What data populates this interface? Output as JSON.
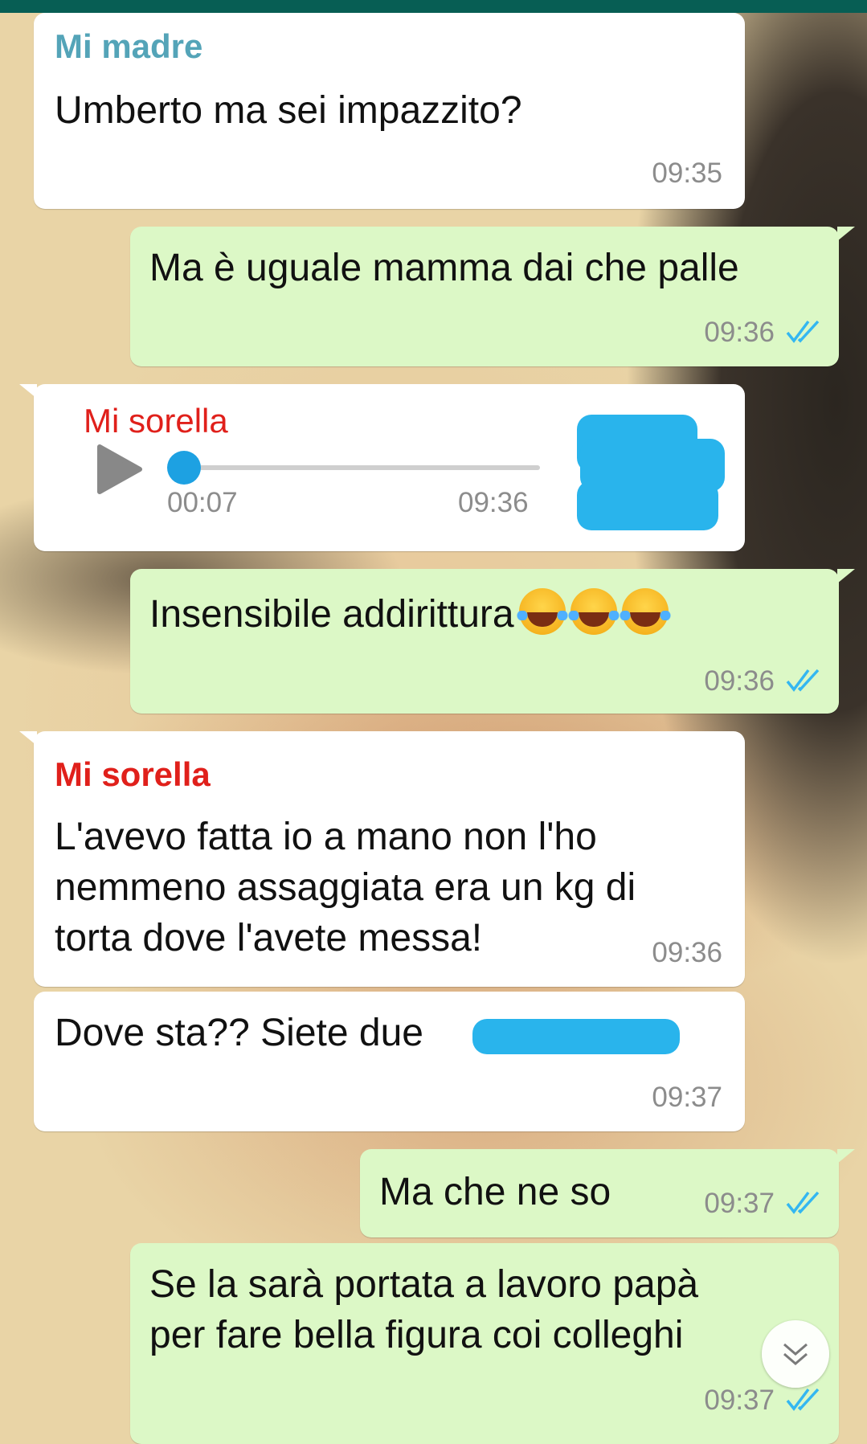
{
  "colors": {
    "header": "#075e54",
    "incoming_bubble": "#ffffff",
    "outgoing_bubble": "#dcf8c6",
    "sender_mother": "#54a4b8",
    "sender_sister": "#e0201b",
    "read_ticks": "#34b7f1",
    "audio_progress": "#1da1e2"
  },
  "messages": [
    {
      "sender": "Mi madre",
      "text": "Umberto ma sei impazzito?",
      "time": "09:35"
    },
    {
      "text": "Ma è uguale mamma dai che palle",
      "time": "09:36",
      "status_icon": "double-check-icon"
    },
    {
      "sender": "Mi sorella",
      "audio_duration": "00:07",
      "time": "09:36",
      "play_icon": "play-icon"
    },
    {
      "text": "Insensibile addirittura",
      "emoji": "face-with-tears-of-joy",
      "time": "09:36",
      "status_icon": "double-check-icon"
    },
    {
      "sender": "Mi sorella",
      "lines": [
        "L'avevo fatta io a mano non l'ho",
        "nemmeno assaggiata era un kg di",
        "torta dove l'avete messa!"
      ],
      "time": "09:36"
    },
    {
      "text": "Dove sta?? Siete due",
      "time": "09:37"
    },
    {
      "text": "Ma che ne so",
      "time": "09:37",
      "status_icon": "double-check-icon"
    },
    {
      "lines": [
        "Se la sarà portata a lavoro papà",
        "per fare bella figura coi colleghi"
      ],
      "time": "09:37",
      "status_icon": "double-check-icon"
    }
  ],
  "scroll_button_icon": "chevron-double-down-icon"
}
